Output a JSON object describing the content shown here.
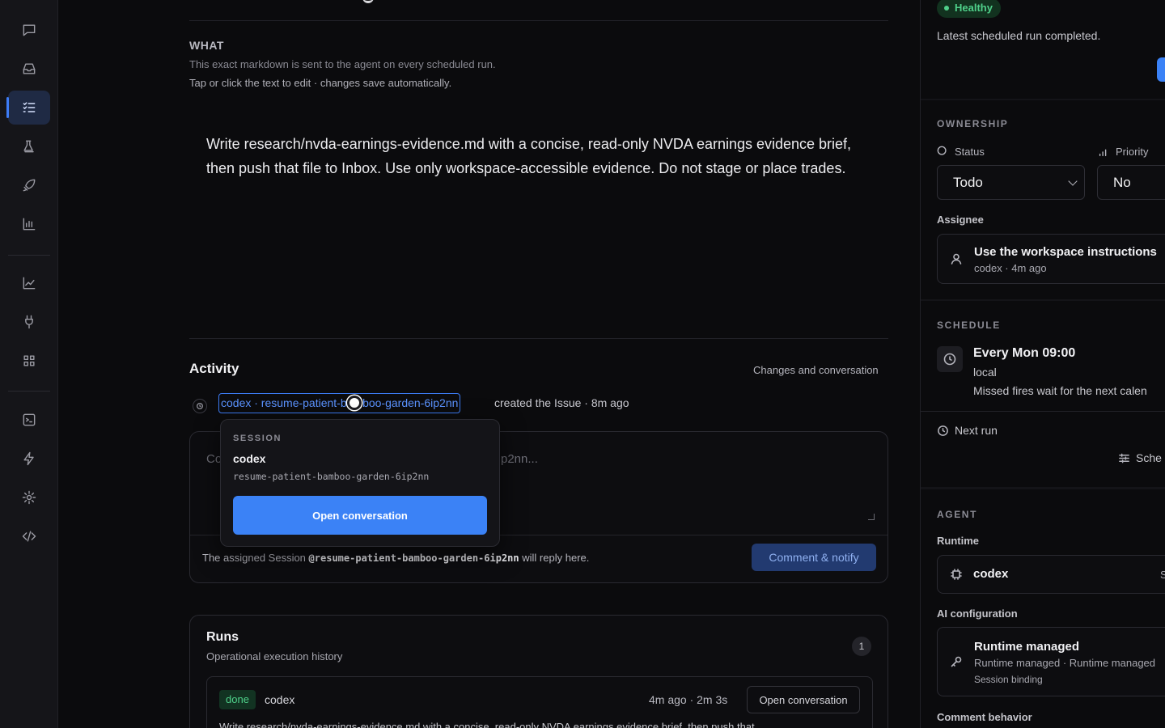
{
  "main": {
    "what": {
      "heading": "WHAT",
      "desc1": "This exact markdown is sent to the agent on every scheduled run.",
      "desc2": "Tap or click the text to edit · changes save automatically.",
      "prompt": "Write research/nvda-earnings-evidence.md with a concise, read-only NVDA earnings evidence brief, then push that file to Inbox. Use only workspace-accessible evidence. Do not stage or place trades."
    },
    "activity": {
      "heading": "Activity",
      "right_label": "Changes and conversation",
      "session_link": "codex · resume-patient-bamboo-garden-6ip2nn",
      "action_text": "created the Issue · 8m ago",
      "comment_placeholder_start": "Co",
      "comment_placeholder_end": "p2nn...",
      "footer_prefix": "The assigned Session",
      "footer_handle": "@resume-patient-bamboo-garden-6ip2nn",
      "footer_suffix": "will reply here.",
      "notify_button": "Comment & notify"
    },
    "popover": {
      "label": "SESSION",
      "name": "codex",
      "session_id": "resume-patient-bamboo-garden-6ip2nn",
      "button": "Open conversation"
    },
    "runs": {
      "heading": "Runs",
      "subtitle": "Operational execution history",
      "count": "1",
      "items": [
        {
          "status": "done",
          "agent": "codex",
          "time": "4m ago · 2m 3s",
          "open_button": "Open conversation",
          "text": "Write research/nvda-earnings-evidence.md with a concise, read-only NVDA earnings evidence brief, then push that"
        }
      ]
    }
  },
  "side": {
    "health_badge": "Healthy",
    "health_desc": "Latest scheduled run completed.",
    "ownership": {
      "heading": "OWNERSHIP",
      "status_label": "Status",
      "status_value": "Todo",
      "priority_label": "Priority",
      "priority_value": "No",
      "assignee_label": "Assignee",
      "assignee_title": "Use the workspace instructions",
      "assignee_sub": "codex · 4m ago"
    },
    "schedule": {
      "heading": "SCHEDULE",
      "cadence": "Every Mon 09:00",
      "timezone": "local",
      "note": "Missed fires wait for the next calen",
      "next_run_label": "Next run",
      "schedule_button": "Sche"
    },
    "agent": {
      "heading": "AGENT",
      "runtime_label": "Runtime",
      "runtime_value": "codex",
      "runtime_suffix": "S",
      "ai_config_label": "AI configuration",
      "ai_title": "Runtime managed",
      "ai_sub": "Runtime managed · Runtime managed",
      "ai_binding": "Session binding",
      "comment_behavior_label": "Comment behavior"
    }
  }
}
